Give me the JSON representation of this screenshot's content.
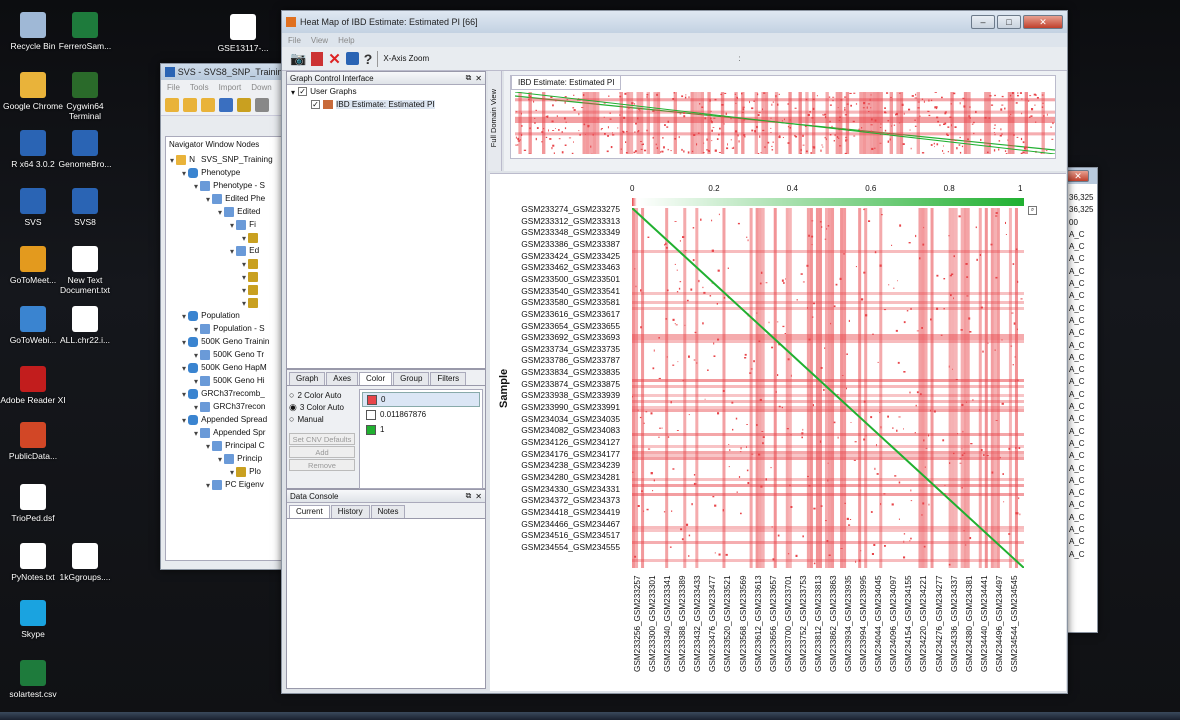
{
  "desktop": {
    "icons": [
      {
        "label": "Recycle Bin",
        "icon": "recycle-bin-icon",
        "color": "#9fb8d6"
      },
      {
        "label": "FerreroSam...",
        "icon": "excel-file-icon",
        "color": "#1e7b3c"
      },
      {
        "label": "Google Chrome",
        "icon": "chrome-icon",
        "color": "#e9b33a"
      },
      {
        "label": "Cygwin64 Terminal",
        "icon": "terminal-icon",
        "color": "#2a6a2a"
      },
      {
        "label": "R x64 3.0.2",
        "icon": "r-icon",
        "color": "#2a64b4"
      },
      {
        "label": "GenomeBro...",
        "icon": "genome-browser-icon",
        "color": "#2a64b4"
      },
      {
        "label": "SVS",
        "icon": "svs-icon",
        "color": "#2a64b4"
      },
      {
        "label": "SVS8",
        "icon": "svs8-icon",
        "color": "#2a64b4"
      },
      {
        "label": "GoToMeet...",
        "icon": "gotomeeting-icon",
        "color": "#e39a1e"
      },
      {
        "label": "New Text Document.txt",
        "icon": "text-file-icon",
        "color": "#ffffff"
      },
      {
        "label": "GoToWebi...",
        "icon": "gotowebinar-icon",
        "color": "#3a84d0"
      },
      {
        "label": "ALL.chr22.i...",
        "icon": "file-icon",
        "color": "#ffffff"
      },
      {
        "label": "Adobe Reader XI",
        "icon": "adobe-reader-icon",
        "color": "#c21d1d"
      },
      {
        "label": "PublicData...",
        "icon": "powerpoint-file-icon",
        "color": "#d24726"
      },
      {
        "label": "TrioPed.dsf",
        "icon": "file-icon",
        "color": "#ffffff"
      },
      {
        "label": "PyNotes.txt",
        "icon": "text-file-icon",
        "color": "#ffffff"
      },
      {
        "label": "1kGgroups....",
        "icon": "file-icon",
        "color": "#ffffff"
      },
      {
        "label": "Skype",
        "icon": "skype-icon",
        "color": "#1aa3e0"
      },
      {
        "label": "solartest.csv",
        "icon": "excel-file-icon",
        "color": "#1e7b3c"
      },
      {
        "label": "GSE13117-...",
        "icon": "file-icon",
        "color": "#ffffff"
      }
    ]
  },
  "svs_window": {
    "title": "SVS - SVS8_SNP_Training",
    "menu": [
      "File",
      "Tools",
      "Import",
      "Down"
    ],
    "nav_title": "Navigator Window Nodes",
    "tree": [
      {
        "label": "SVS_SNP_Training",
        "level": 0,
        "icon": "folder-icon",
        "prefix": "N"
      },
      {
        "label": "Phenotype",
        "level": 1,
        "icon": "database-icon"
      },
      {
        "label": "Phenotype - S",
        "level": 2,
        "icon": "spreadsheet-icon"
      },
      {
        "label": "Edited Phe",
        "level": 3,
        "icon": "spreadsheet-icon"
      },
      {
        "label": "Edited",
        "level": 4,
        "icon": "spreadsheet-icon"
      },
      {
        "label": "Fi",
        "level": 5,
        "icon": "spreadsheet-icon"
      },
      {
        "label": "",
        "level": 6,
        "icon": "chart-icon"
      },
      {
        "label": "Ed",
        "level": 5,
        "icon": "spreadsheet-icon"
      },
      {
        "label": "",
        "level": 6,
        "icon": "chart-icon"
      },
      {
        "label": "",
        "level": 6,
        "icon": "chart-icon"
      },
      {
        "label": "",
        "level": 6,
        "icon": "chart-icon"
      },
      {
        "label": "",
        "level": 6,
        "icon": "chart-icon"
      },
      {
        "label": "Population",
        "level": 1,
        "icon": "database-icon"
      },
      {
        "label": "Population - S",
        "level": 2,
        "icon": "spreadsheet-icon"
      },
      {
        "label": "500K Geno Trainin",
        "level": 1,
        "icon": "database-icon"
      },
      {
        "label": "500K Geno Tr",
        "level": 2,
        "icon": "spreadsheet-icon"
      },
      {
        "label": "500K Geno HapM",
        "level": 1,
        "icon": "database-icon"
      },
      {
        "label": "500K Geno Hi",
        "level": 2,
        "icon": "spreadsheet-icon"
      },
      {
        "label": "GRCh37recomb_",
        "level": 1,
        "icon": "database-icon"
      },
      {
        "label": "GRCh37recon",
        "level": 2,
        "icon": "spreadsheet-icon"
      },
      {
        "label": "Appended Spread",
        "level": 1,
        "icon": "database-icon"
      },
      {
        "label": "Appended Spr",
        "level": 2,
        "icon": "spreadsheet-icon"
      },
      {
        "label": "Principal C",
        "level": 3,
        "icon": "spreadsheet-icon"
      },
      {
        "label": "Princip",
        "level": 4,
        "icon": "spreadsheet-icon"
      },
      {
        "label": "Plo",
        "level": 5,
        "icon": "chart-icon"
      },
      {
        "label": "PC Eigenv",
        "level": 3,
        "icon": "spreadsheet-icon"
      }
    ]
  },
  "back_window_values": [
    "36,325",
    "36,325",
    "00",
    "A_C",
    "A_C",
    "A_C",
    "A_C",
    "A_C",
    "A_C",
    "A_C",
    "A_C",
    "A_C",
    "A_C",
    "A_C",
    "A_C",
    "A_C",
    "A_C",
    "A_C",
    "A_C",
    "A_C",
    "A_C",
    "A_C",
    "A_C",
    "A_C",
    "A_C",
    "A_C",
    "A_C",
    "A_C",
    "A_C",
    "A_C"
  ],
  "heatmap_window": {
    "title": "Heat Map of IBD Estimate: Estimated PI [66]",
    "menu": [
      "File",
      "View",
      "Help"
    ],
    "toolbar_label": "X-Axis Zoom",
    "graph_panel_title": "Graph Control Interface",
    "tree": {
      "root": "User Graphs",
      "child": "IBD Estimate:  Estimated PI"
    },
    "tabs": [
      "Graph",
      "Axes",
      "Color",
      "Group",
      "Filters"
    ],
    "active_tab": "Color",
    "color_modes": [
      {
        "label": "2 Color Auto",
        "checked": false
      },
      {
        "label": "3 Color Auto",
        "checked": true
      },
      {
        "label": "Manual",
        "checked": false
      }
    ],
    "color_stops": [
      {
        "value": "0",
        "color": "#e8454a"
      },
      {
        "value": "0.011867876",
        "color": "#ffffff"
      },
      {
        "value": "1",
        "color": "#20b030"
      }
    ],
    "buttons": [
      "Set CNV Defaults",
      "Add",
      "Remove"
    ],
    "console_title": "Data Console",
    "console_tabs": [
      "Current",
      "History",
      "Notes"
    ],
    "full_domain_label": "Full Domain View",
    "overview_title": "IBD Estimate:  Estimated PI",
    "y_axis_title": "Sample",
    "colorbar_ticks": [
      "0",
      "0.2",
      "0.4",
      "0.6",
      "0.8",
      "1"
    ],
    "y_labels": [
      "GSM233274_GSM233275",
      "GSM233312_GSM233313",
      "GSM233348_GSM233349",
      "GSM233386_GSM233387",
      "GSM233424_GSM233425",
      "GSM233462_GSM233463",
      "GSM233500_GSM233501",
      "GSM233540_GSM233541",
      "GSM233580_GSM233581",
      "GSM233616_GSM233617",
      "GSM233654_GSM233655",
      "GSM233692_GSM233693",
      "GSM233734_GSM233735",
      "GSM233786_GSM233787",
      "GSM233834_GSM233835",
      "GSM233874_GSM233875",
      "GSM233938_GSM233939",
      "GSM233990_GSM233991",
      "GSM234034_GSM234035",
      "GSM234082_GSM234083",
      "GSM234126_GSM234127",
      "GSM234176_GSM234177",
      "GSM234238_GSM234239",
      "GSM234280_GSM234281",
      "GSM234330_GSM234331",
      "GSM234372_GSM234373",
      "GSM234418_GSM234419",
      "GSM234466_GSM234467",
      "GSM234516_GSM234517",
      "GSM234554_GSM234555"
    ],
    "x_labels": [
      "GSM233256_GSM233257",
      "GSM233300_GSM233301",
      "GSM233340_GSM233341",
      "GSM233388_GSM233389",
      "GSM233432_GSM233433",
      "GSM233476_GSM233477",
      "GSM233520_GSM233521",
      "GSM233568_GSM233569",
      "GSM233612_GSM233613",
      "GSM233656_GSM233657",
      "GSM233700_GSM233701",
      "GSM233752_GSM233753",
      "GSM233812_GSM233813",
      "GSM233862_GSM233863",
      "GSM233934_GSM233935",
      "GSM233994_GSM233995",
      "GSM234044_GSM234045",
      "GSM234096_GSM234097",
      "GSM234154_GSM234155",
      "GSM234220_GSM234221",
      "GSM234276_GSM234277",
      "GSM234336_GSM234337",
      "GSM234380_GSM234381",
      "GSM234440_GSM234441",
      "GSM234496_GSM234497",
      "GSM234544_GSM234545"
    ]
  }
}
